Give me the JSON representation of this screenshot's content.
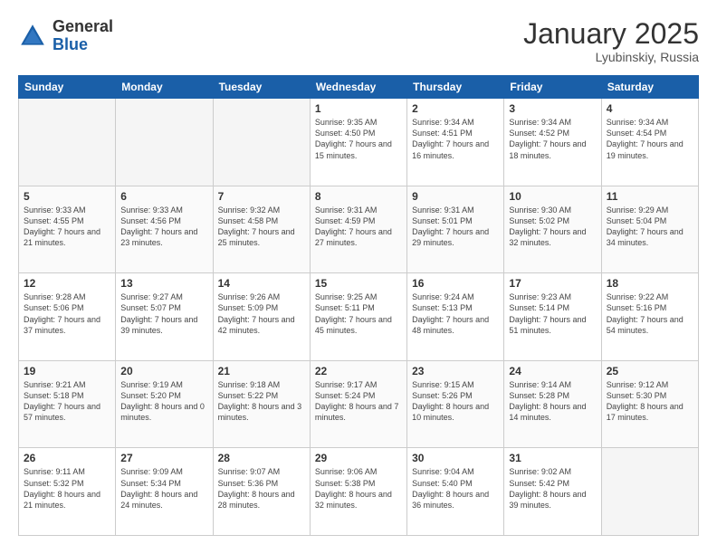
{
  "header": {
    "logo_general": "General",
    "logo_blue": "Blue",
    "month_title": "January 2025",
    "location": "Lyubinskiy, Russia"
  },
  "weekdays": [
    "Sunday",
    "Monday",
    "Tuesday",
    "Wednesday",
    "Thursday",
    "Friday",
    "Saturday"
  ],
  "weeks": [
    [
      {
        "day": "",
        "empty": true
      },
      {
        "day": "",
        "empty": true
      },
      {
        "day": "",
        "empty": true
      },
      {
        "day": "1",
        "sunrise": "9:35 AM",
        "sunset": "4:50 PM",
        "daylight": "7 hours and 15 minutes."
      },
      {
        "day": "2",
        "sunrise": "9:34 AM",
        "sunset": "4:51 PM",
        "daylight": "7 hours and 16 minutes."
      },
      {
        "day": "3",
        "sunrise": "9:34 AM",
        "sunset": "4:52 PM",
        "daylight": "7 hours and 18 minutes."
      },
      {
        "day": "4",
        "sunrise": "9:34 AM",
        "sunset": "4:54 PM",
        "daylight": "7 hours and 19 minutes."
      }
    ],
    [
      {
        "day": "5",
        "sunrise": "9:33 AM",
        "sunset": "4:55 PM",
        "daylight": "7 hours and 21 minutes."
      },
      {
        "day": "6",
        "sunrise": "9:33 AM",
        "sunset": "4:56 PM",
        "daylight": "7 hours and 23 minutes."
      },
      {
        "day": "7",
        "sunrise": "9:32 AM",
        "sunset": "4:58 PM",
        "daylight": "7 hours and 25 minutes."
      },
      {
        "day": "8",
        "sunrise": "9:31 AM",
        "sunset": "4:59 PM",
        "daylight": "7 hours and 27 minutes."
      },
      {
        "day": "9",
        "sunrise": "9:31 AM",
        "sunset": "5:01 PM",
        "daylight": "7 hours and 29 minutes."
      },
      {
        "day": "10",
        "sunrise": "9:30 AM",
        "sunset": "5:02 PM",
        "daylight": "7 hours and 32 minutes."
      },
      {
        "day": "11",
        "sunrise": "9:29 AM",
        "sunset": "5:04 PM",
        "daylight": "7 hours and 34 minutes."
      }
    ],
    [
      {
        "day": "12",
        "sunrise": "9:28 AM",
        "sunset": "5:06 PM",
        "daylight": "7 hours and 37 minutes."
      },
      {
        "day": "13",
        "sunrise": "9:27 AM",
        "sunset": "5:07 PM",
        "daylight": "7 hours and 39 minutes."
      },
      {
        "day": "14",
        "sunrise": "9:26 AM",
        "sunset": "5:09 PM",
        "daylight": "7 hours and 42 minutes."
      },
      {
        "day": "15",
        "sunrise": "9:25 AM",
        "sunset": "5:11 PM",
        "daylight": "7 hours and 45 minutes."
      },
      {
        "day": "16",
        "sunrise": "9:24 AM",
        "sunset": "5:13 PM",
        "daylight": "7 hours and 48 minutes."
      },
      {
        "day": "17",
        "sunrise": "9:23 AM",
        "sunset": "5:14 PM",
        "daylight": "7 hours and 51 minutes."
      },
      {
        "day": "18",
        "sunrise": "9:22 AM",
        "sunset": "5:16 PM",
        "daylight": "7 hours and 54 minutes."
      }
    ],
    [
      {
        "day": "19",
        "sunrise": "9:21 AM",
        "sunset": "5:18 PM",
        "daylight": "7 hours and 57 minutes."
      },
      {
        "day": "20",
        "sunrise": "9:19 AM",
        "sunset": "5:20 PM",
        "daylight": "8 hours and 0 minutes."
      },
      {
        "day": "21",
        "sunrise": "9:18 AM",
        "sunset": "5:22 PM",
        "daylight": "8 hours and 3 minutes."
      },
      {
        "day": "22",
        "sunrise": "9:17 AM",
        "sunset": "5:24 PM",
        "daylight": "8 hours and 7 minutes."
      },
      {
        "day": "23",
        "sunrise": "9:15 AM",
        "sunset": "5:26 PM",
        "daylight": "8 hours and 10 minutes."
      },
      {
        "day": "24",
        "sunrise": "9:14 AM",
        "sunset": "5:28 PM",
        "daylight": "8 hours and 14 minutes."
      },
      {
        "day": "25",
        "sunrise": "9:12 AM",
        "sunset": "5:30 PM",
        "daylight": "8 hours and 17 minutes."
      }
    ],
    [
      {
        "day": "26",
        "sunrise": "9:11 AM",
        "sunset": "5:32 PM",
        "daylight": "8 hours and 21 minutes."
      },
      {
        "day": "27",
        "sunrise": "9:09 AM",
        "sunset": "5:34 PM",
        "daylight": "8 hours and 24 minutes."
      },
      {
        "day": "28",
        "sunrise": "9:07 AM",
        "sunset": "5:36 PM",
        "daylight": "8 hours and 28 minutes."
      },
      {
        "day": "29",
        "sunrise": "9:06 AM",
        "sunset": "5:38 PM",
        "daylight": "8 hours and 32 minutes."
      },
      {
        "day": "30",
        "sunrise": "9:04 AM",
        "sunset": "5:40 PM",
        "daylight": "8 hours and 36 minutes."
      },
      {
        "day": "31",
        "sunrise": "9:02 AM",
        "sunset": "5:42 PM",
        "daylight": "8 hours and 39 minutes."
      },
      {
        "day": "",
        "empty": true
      }
    ]
  ]
}
